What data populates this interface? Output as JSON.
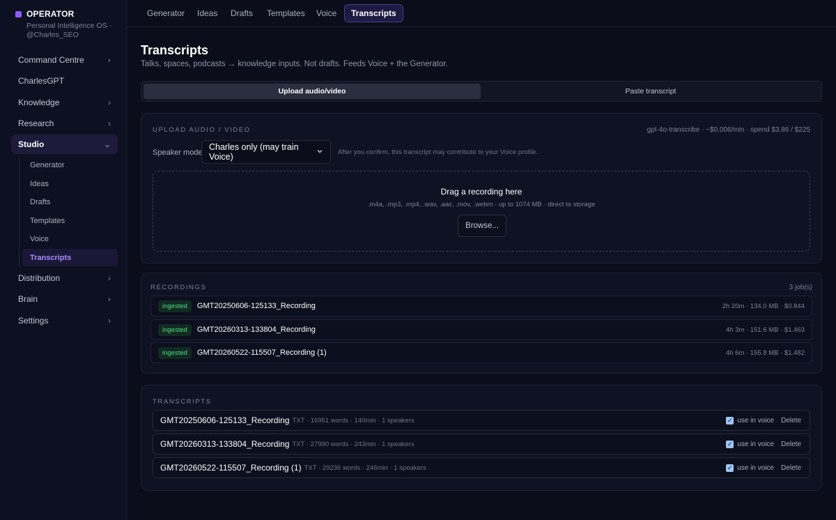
{
  "brand": {
    "title": "OPERATOR",
    "subtitle": "Personal Intelligence OS · @Charles_SEO",
    "accent": "#8b5cf6"
  },
  "sidebar": {
    "items": [
      {
        "label": "Command Centre",
        "chevron": "›"
      },
      {
        "label": "CharlesGPT",
        "chevron": ""
      },
      {
        "label": "Knowledge",
        "chevron": "›"
      },
      {
        "label": "Research",
        "chevron": "›"
      },
      {
        "label": "Studio",
        "chevron": "⌄"
      },
      {
        "label": "Distribution",
        "chevron": "›"
      },
      {
        "label": "Brain",
        "chevron": "›"
      },
      {
        "label": "Settings",
        "chevron": "›"
      }
    ],
    "studio_children": [
      "Generator",
      "Ideas",
      "Drafts",
      "Templates",
      "Voice",
      "Transcripts"
    ],
    "active_item": "Studio",
    "active_child": "Transcripts"
  },
  "tabs": [
    "Generator",
    "Ideas",
    "Drafts",
    "Templates",
    "Voice",
    "Transcripts"
  ],
  "active_tab": "Transcripts",
  "header": {
    "title": "Transcripts",
    "subtitle": "Talks, spaces, podcasts → knowledge inputs. Not drafts. Feeds Voice + the Generator."
  },
  "mode": {
    "upload_label": "Upload audio/video",
    "paste_label": "Paste transcript",
    "selected": "Upload audio/video"
  },
  "upload": {
    "label": "UPLOAD AUDIO / VIDEO",
    "model_info": "gpt-4o-transcribe · ~$0.006/min · spend $3.86 / $225",
    "speaker_label": "Speaker mode",
    "speaker_value": "Charles only (may train Voice)",
    "speaker_note": "After you confirm, this transcript may contribute to your Voice profile.",
    "drop_title": "Drag a recording here",
    "drop_sub": ".m4a, .mp3, .mp4, .wav, .aac, .mov, .webm · up to 1074 MB · direct to storage",
    "browse_label": "Browse..."
  },
  "recordings": {
    "label": "RECORDINGS",
    "count": "3 job(s)",
    "rows": [
      {
        "status": "ingested",
        "name": "GMT20250606-125133_Recording",
        "meta": "2h 20m · 134.0 MB · $0.844"
      },
      {
        "status": "ingested",
        "name": "GMT20260313-133804_Recording",
        "meta": "4h 3m · 151.6 MB · $1.463"
      },
      {
        "status": "ingested",
        "name": "GMT20260522-115507_Recording (1)",
        "meta": "4h 6m · 155.8 MB · $1.482"
      }
    ]
  },
  "transcripts": {
    "label": "TRANSCRIPTS",
    "use_label": "use in voice",
    "delete_label": "Delete",
    "rows": [
      {
        "name": "GMT20250606-125133_Recording",
        "meta": "TXT · 16951 words · 140min · 1 speakers",
        "use_in_voice": true
      },
      {
        "name": "GMT20260313-133804_Recording",
        "meta": "TXT · 27990 words · 243min · 1 speakers",
        "use_in_voice": true
      },
      {
        "name": "GMT20260522-115507_Recording (1)",
        "meta": "TXT · 29236 words · 246min · 1 speakers",
        "use_in_voice": true
      }
    ]
  }
}
